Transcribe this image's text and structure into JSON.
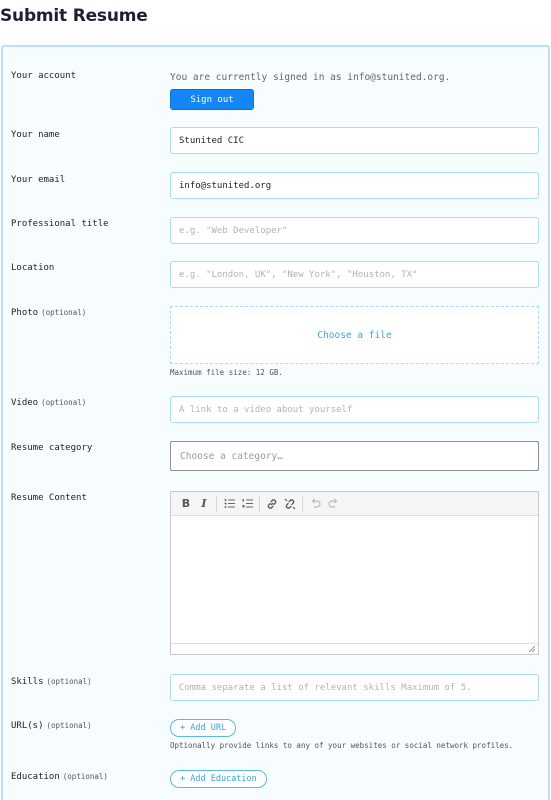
{
  "page_title": "Submit Resume",
  "account": {
    "label": "Your account",
    "signed_in_text": "You are currently signed in as info@stunited.org.",
    "sign_out_label": "Sign out"
  },
  "name": {
    "label": "Your name",
    "value": "Stunited CIC"
  },
  "email": {
    "label": "Your email",
    "value": "info@stunited.org"
  },
  "professional_title": {
    "label": "Professional title",
    "placeholder": "e.g. \"Web Developer\""
  },
  "location": {
    "label": "Location",
    "placeholder": "e.g. \"London, UK\", \"New York\", \"Houston, TX\""
  },
  "photo": {
    "label": "Photo",
    "optional": "(optional)",
    "choose_label": "Choose a file",
    "max_size_text": "Maximum file size: 12 GB."
  },
  "video": {
    "label": "Video",
    "optional": "(optional)",
    "placeholder": "A link to a video about yourself"
  },
  "category": {
    "label": "Resume category",
    "placeholder": "Choose a category…"
  },
  "content": {
    "label": "Resume Content",
    "toolbar": [
      "bold-icon",
      "italic-icon",
      "bullet-list-icon",
      "numbered-list-icon",
      "link-icon",
      "unlink-icon",
      "undo-icon",
      "redo-icon"
    ]
  },
  "skills": {
    "label": "Skills",
    "optional": "(optional)",
    "placeholder": "Comma separate a list of relevant skills Maximum of 5."
  },
  "urls": {
    "label": "URL(s)",
    "optional": "(optional)",
    "add_label": "+ Add URL",
    "hint": "Optionally provide links to any of your websites or social network profiles."
  },
  "education": {
    "label": "Education",
    "optional": "(optional)",
    "add_label": "+ Add Education"
  },
  "colors": {
    "accent": "#1486f5",
    "border": "#a9dcef",
    "link": "#3aa3e0"
  }
}
